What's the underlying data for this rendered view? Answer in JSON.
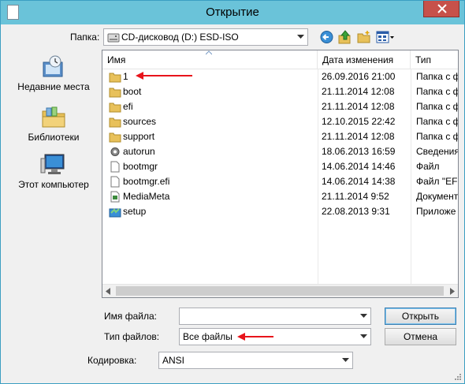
{
  "window": {
    "title": "Открытие"
  },
  "lookin": {
    "label": "Папка:",
    "value": "CD-дисковод (D:) ESD-ISO"
  },
  "toolbar": {
    "icons": [
      "back-icon",
      "up-folder-icon",
      "new-folder-icon",
      "view-menu-icon"
    ]
  },
  "places": [
    {
      "label": "Недавние места",
      "icon": "recent-places-icon"
    },
    {
      "label": "Библиотеки",
      "icon": "libraries-icon"
    },
    {
      "label": "Этот компьютер",
      "icon": "computer-icon"
    }
  ],
  "columns": {
    "name": "Имя",
    "date": "Дата изменения",
    "type": "Тип"
  },
  "files": [
    {
      "name": "1",
      "date": "26.09.2016 21:00",
      "type": "Папка с ф",
      "icon": "folder-icon"
    },
    {
      "name": "boot",
      "date": "21.11.2014 12:08",
      "type": "Папка с ф",
      "icon": "folder-icon"
    },
    {
      "name": "efi",
      "date": "21.11.2014 12:08",
      "type": "Папка с ф",
      "icon": "folder-icon"
    },
    {
      "name": "sources",
      "date": "12.10.2015 22:42",
      "type": "Папка с ф",
      "icon": "folder-icon"
    },
    {
      "name": "support",
      "date": "21.11.2014 12:08",
      "type": "Папка с ф",
      "icon": "folder-icon"
    },
    {
      "name": "autorun",
      "date": "18.06.2013 16:59",
      "type": "Сведения",
      "icon": "settings-file-icon"
    },
    {
      "name": "bootmgr",
      "date": "14.06.2014 14:46",
      "type": "Файл",
      "icon": "file-icon"
    },
    {
      "name": "bootmgr.efi",
      "date": "14.06.2014 14:38",
      "type": "Файл \"EFI",
      "icon": "file-icon"
    },
    {
      "name": "MediaMeta",
      "date": "21.11.2014 9:52",
      "type": "Документ",
      "icon": "xml-document-icon"
    },
    {
      "name": "setup",
      "date": "22.08.2013 9:31",
      "type": "Приложе",
      "icon": "setup-app-icon"
    }
  ],
  "filename": {
    "label": "Имя файла:",
    "value": ""
  },
  "filetype": {
    "label": "Тип файлов:",
    "value": "Все файлы"
  },
  "encoding": {
    "label": "Кодировка:",
    "value": "ANSI"
  },
  "buttons": {
    "open": "Открыть",
    "cancel": "Отмена"
  },
  "colors": {
    "titlebar": "#6ac3d9",
    "close": "#c7514a",
    "annotation_arrow": "#e8141b",
    "folder": "#e8c15a"
  }
}
